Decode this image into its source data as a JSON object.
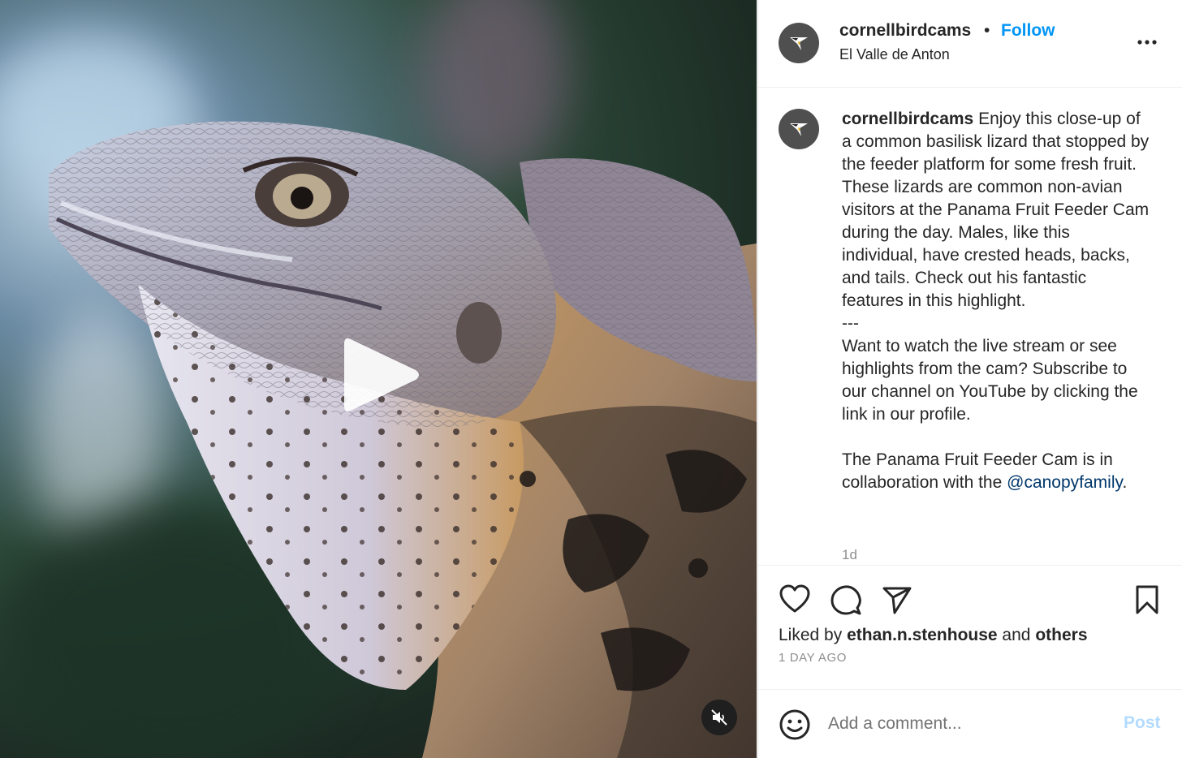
{
  "post": {
    "username": "cornellbirdcams",
    "separator": "•",
    "follow_label": "Follow",
    "location": "El Valle de Anton"
  },
  "caption": {
    "username": "cornellbirdcams",
    "text_before_mention": " Enjoy this close-up of a common basilisk lizard that stopped by the feeder platform for some fresh fruit. These lizards are common non-avian visitors at the Panama Fruit Feeder Cam during the day. Males, like this individual, have crested heads, backs, and tails. Check out his fantastic features in this highlight.\n---\nWant to watch the live stream or see highlights from the cam? Subscribe to our channel on YouTube by clicking the link in our profile.\n\nThe Panama Fruit Feeder Cam is in collaboration with the ",
    "mention": "@canopyfamily",
    "text_after_mention": ".",
    "age": "1d"
  },
  "likes": {
    "prefix": "Liked by ",
    "liker": "ethan.n.stenhouse",
    "conjunction": " and ",
    "others": "others",
    "post_age": "1 DAY AGO"
  },
  "comment": {
    "placeholder": "Add a comment...",
    "post_label": "Post"
  },
  "icons": {
    "play": "play-icon",
    "mute": "muted-speaker-icon",
    "more": "more-options-icon",
    "like": "heart-icon",
    "comment": "comment-bubble-icon",
    "share": "paper-plane-icon",
    "save": "bookmark-icon",
    "emoji": "smiley-icon"
  },
  "colors": {
    "link_blue": "#0095f6",
    "mention_blue": "#00376b",
    "post_disabled": "#b3dbff",
    "secondary_text": "#8e8e8e"
  }
}
